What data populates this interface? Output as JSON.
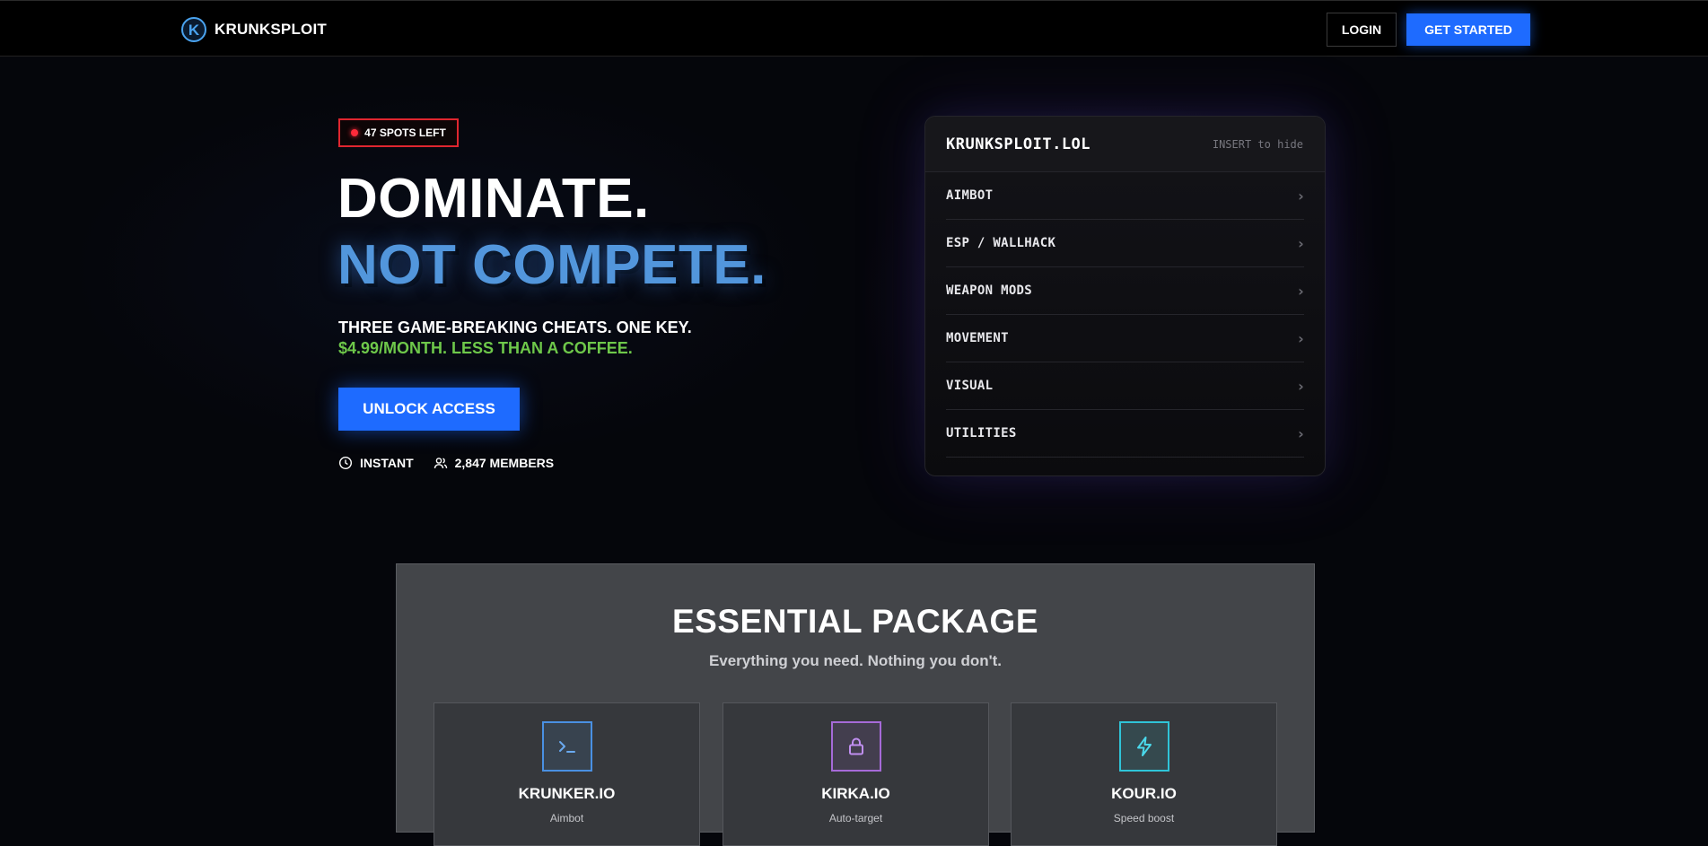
{
  "nav": {
    "brand": "KRUNKSPLOIT",
    "logo_letter": "K",
    "login_label": "LOGIN",
    "get_started_label": "GET STARTED"
  },
  "hero": {
    "badge": "47 SPOTS LEFT",
    "headline_1": "DOMINATE.",
    "headline_2": "NOT COMPETE.",
    "sub_1": "THREE GAME-BREAKING CHEATS. ONE KEY.",
    "sub_2": "$4.99/MONTH. LESS THAN A COFFEE.",
    "cta_label": "UNLOCK ACCESS",
    "stat_instant": "INSTANT",
    "stat_members": "2,847 MEMBERS"
  },
  "panel": {
    "title": "KRUNKSPLOIT.LOL",
    "hint": "INSERT to hide",
    "items": [
      {
        "label": "AIMBOT"
      },
      {
        "label": "ESP / WALLHACK"
      },
      {
        "label": "WEAPON MODS"
      },
      {
        "label": "MOVEMENT"
      },
      {
        "label": "VISUAL"
      },
      {
        "label": "UTILITIES"
      }
    ]
  },
  "package": {
    "title": "ESSENTIAL PACKAGE",
    "subtitle": "Everything you need. Nothing you don't.",
    "cards": [
      {
        "name": "KRUNKER.IO",
        "desc": "Aimbot",
        "icon": "terminal-icon",
        "color": "#4a90e2"
      },
      {
        "name": "KIRKA.IO",
        "desc": "Auto-target",
        "icon": "lock-icon",
        "color": "#a66ad8"
      },
      {
        "name": "KOUR.IO",
        "desc": "Speed boost",
        "icon": "lightning-icon",
        "color": "#2fc4d8"
      }
    ]
  },
  "colors": {
    "accent_blue": "#1e6bff",
    "headline_blue": "#5296dc",
    "price_green": "#6ec84a",
    "badge_red": "#e0262f"
  }
}
